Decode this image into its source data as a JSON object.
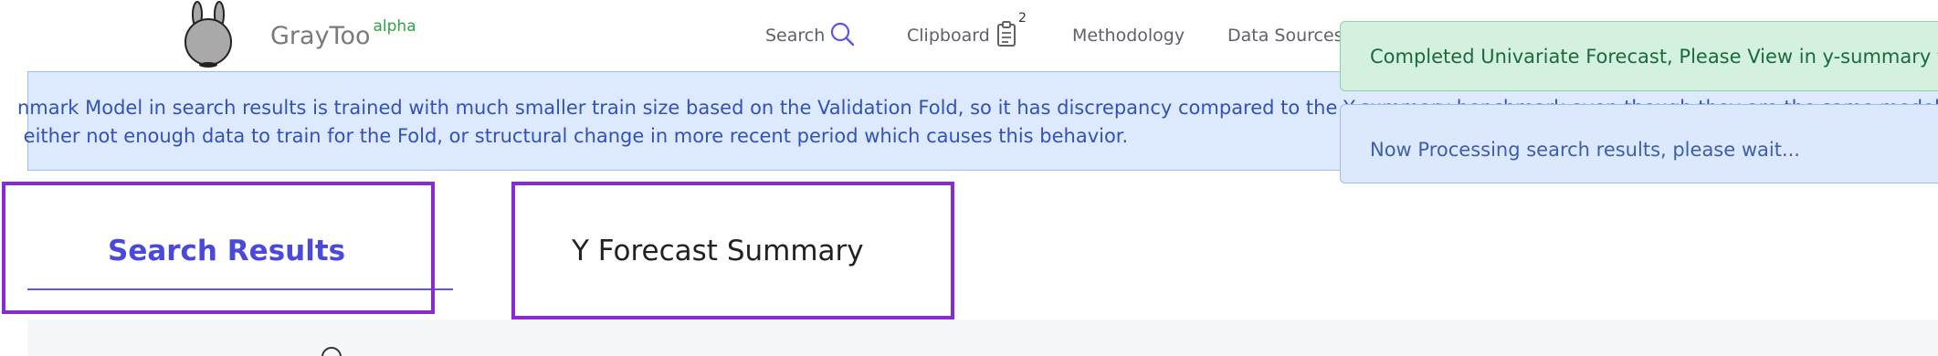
{
  "header": {
    "brand": "GrayToo",
    "brand_badge": "alpha",
    "nav": {
      "search": "Search",
      "clipboard": "Clipboard",
      "clipboard_count": "2",
      "methodology": "Methodology",
      "data_sources": "Data Sources"
    }
  },
  "banner": {
    "line1": "nmark Model in search results is trained with much smaller train size based on the Validation Fold, so it has discrepancy compared to the Y-summary benchmark even though they are the same model. If the discrepancy is",
    "line2": " either not enough data to train for the Fold, or structural change in more recent period which causes this behavior."
  },
  "toasts": {
    "success": "Completed Univariate Forecast, Please View in y-summary tab.",
    "info": "Now Processing search results, please wait..."
  },
  "tabs": {
    "search_results": "Search Results",
    "forecast_summary": "Y Forecast Summary"
  },
  "colors": {
    "accent": "#4b48dc",
    "highlight_border": "#8a2bd1",
    "brand_badge": "#28a745",
    "banner_bg": "#dde9fc",
    "toast_success_bg": "#d4f1df"
  }
}
